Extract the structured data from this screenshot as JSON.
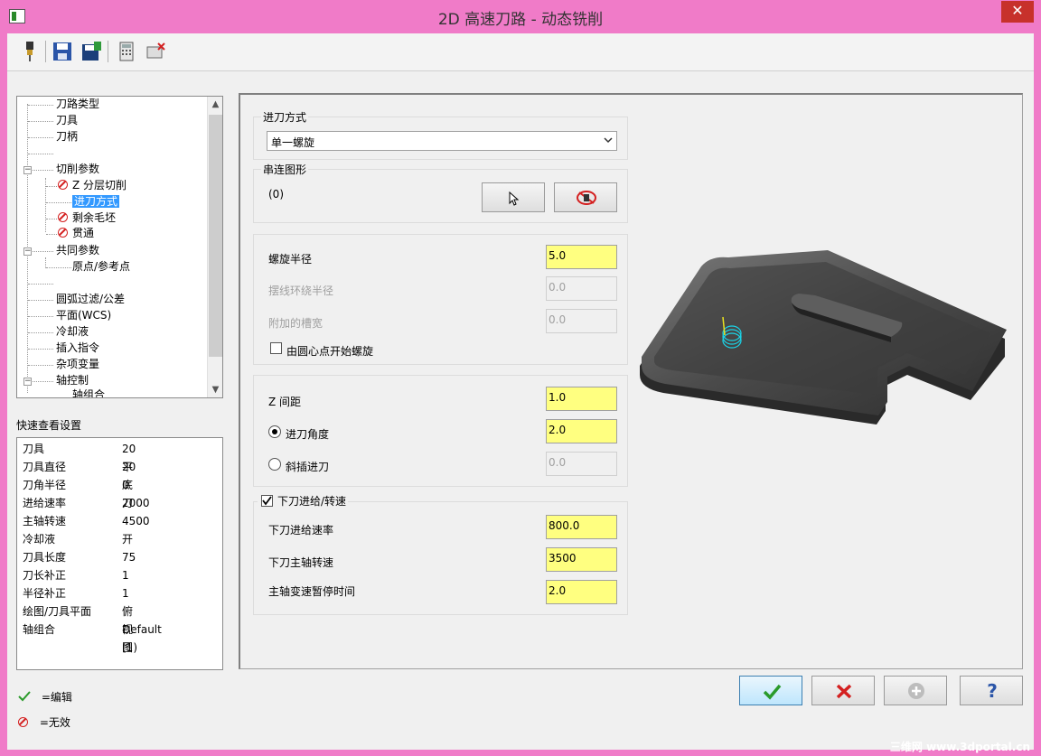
{
  "window": {
    "title": "2D 高速刀路 - 动态铣削",
    "close_glyph": "✕"
  },
  "toolbar": {
    "icons": [
      "tool-icon",
      "save-icon",
      "save-as-icon",
      "calculator-icon",
      "remove-icon"
    ]
  },
  "tree": {
    "items": [
      {
        "label": "刀路类型",
        "state": "normal"
      },
      {
        "label": "刀具",
        "state": "normal"
      },
      {
        "label": "刀柄",
        "state": "normal"
      },
      {
        "label": "",
        "state": "normal"
      },
      {
        "label": "切削参数",
        "state": "expanded"
      },
      {
        "label": "Z 分层切削",
        "state": "invalid"
      },
      {
        "label": "进刀方式",
        "state": "selected"
      },
      {
        "label": "剩余毛坯",
        "state": "invalid"
      },
      {
        "label": "贯通",
        "state": "invalid"
      },
      {
        "label": "共同参数",
        "state": "expanded"
      },
      {
        "label": "原点/参考点",
        "state": "normal"
      },
      {
        "label": "",
        "state": "normal"
      },
      {
        "label": "圆弧过滤/公差",
        "state": "normal"
      },
      {
        "label": "平面(WCS)",
        "state": "normal"
      },
      {
        "label": "冷却液",
        "state": "normal"
      },
      {
        "label": "插入指令",
        "state": "normal"
      },
      {
        "label": "杂项变量",
        "state": "normal"
      },
      {
        "label": "轴控制",
        "state": "expanded"
      },
      {
        "label": "轴组合",
        "state": "normal"
      }
    ]
  },
  "quick_settings": {
    "title": "快速查看设置",
    "rows": [
      {
        "key": "刀具",
        "value": "20 平底刀"
      },
      {
        "key": "刀具直径",
        "value": "20"
      },
      {
        "key": "刀角半径",
        "value": "0"
      },
      {
        "key": "进给速率",
        "value": "2000"
      },
      {
        "key": "主轴转速",
        "value": "4500"
      },
      {
        "key": "冷却液",
        "value": "开"
      },
      {
        "key": "刀具长度",
        "value": "75"
      },
      {
        "key": "刀长补正",
        "value": "1"
      },
      {
        "key": "半径补正",
        "value": "1"
      },
      {
        "key": "绘图/刀具平面",
        "value": "俯视图"
      },
      {
        "key": "轴组合",
        "value": "Default (1)"
      }
    ]
  },
  "legend": {
    "edit": "=编辑",
    "invalid": "=无效"
  },
  "entry": {
    "group_title": "进刀方式",
    "method_value": "单一螺旋",
    "chain_title": "串连图形",
    "chain_count": "(0)"
  },
  "helix": {
    "radius_label": "螺旋半径",
    "radius_value": "5.0",
    "trochoid_label": "摆线环绕半径",
    "trochoid_value": "0.0",
    "slot_label": "附加的槽宽",
    "slot_value": "0.0",
    "center_label": "由圆心点开始螺旋"
  },
  "z": {
    "step_label": "Z 间距",
    "step_value": "1.0",
    "angle_label": "进刀角度",
    "angle_value": "2.0",
    "ramp_label": "斜插进刀",
    "ramp_value": "0.0"
  },
  "plunge": {
    "group_title": "下刀进给/转速",
    "feed_label": "下刀进给速率",
    "feed_value": "800.0",
    "speed_label": "下刀主轴转速",
    "speed_value": "3500",
    "dwell_label": "主轴变速暂停时间",
    "dwell_value": "2.0"
  },
  "watermark": "三维网 www.3dportal.cn",
  "colors": {
    "frame": "#f07bc8",
    "field_active": "#ffff80",
    "selection": "#3399ff"
  }
}
